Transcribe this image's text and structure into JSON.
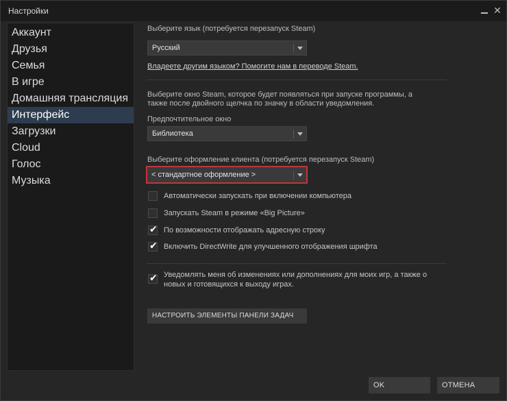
{
  "window": {
    "title": "Настройки"
  },
  "sidebar": {
    "items": [
      {
        "label": "Аккаунт"
      },
      {
        "label": "Друзья"
      },
      {
        "label": "Семья"
      },
      {
        "label": "В игре"
      },
      {
        "label": "Домашняя трансляция"
      },
      {
        "label": "Интерфейс"
      },
      {
        "label": "Загрузки"
      },
      {
        "label": "Cloud"
      },
      {
        "label": "Голос"
      },
      {
        "label": "Музыка"
      }
    ],
    "active": "Интерфейс"
  },
  "language": {
    "label": "Выберите язык (потребуется перезапуск Steam)",
    "value": "Русский",
    "help_link": "Владеете другим языком? Помогите нам в переводе Steam."
  },
  "startup_window": {
    "description_line1": "Выберите окно Steam, которое будет появляться при запуске программы, а",
    "description_line2": "также после двойного щелчка по значку в области уведомления.",
    "label": "Предпочтительное окно",
    "value": "Библиотека"
  },
  "skin": {
    "label": "Выберите оформление клиента (потребуется перезапуск Steam)",
    "value": "< стандартное оформление >"
  },
  "options": [
    {
      "label": "Автоматически запускать при включении компьютера",
      "checked": false
    },
    {
      "label": "Запускать Steam в режиме «Big Picture»",
      "checked": false
    },
    {
      "label": "По возможности отображать адресную строку",
      "checked": true
    },
    {
      "label": "Включить DirectWrite для улучшенного отображения шрифта",
      "checked": true
    }
  ],
  "notify": {
    "line1": "Уведомлять меня об изменениях или дополнениях для моих игр, а также о",
    "line2": "новых и готовящихся к выходу играх.",
    "checked": true
  },
  "taskbar_button": "НАСТРОИТЬ ЭЛЕМЕНТЫ ПАНЕЛИ ЗАДАЧ",
  "footer": {
    "ok": "OK",
    "cancel": "ОТМЕНА"
  },
  "icons": {
    "minimize": "minimize-icon",
    "close": "close-icon",
    "dropdown": "chevron-down-icon",
    "check": "checkmark-icon"
  }
}
